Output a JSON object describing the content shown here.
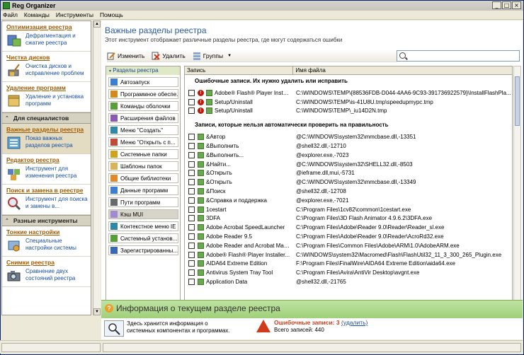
{
  "window": {
    "title": "Reg Organizer",
    "min": "_",
    "max": "□",
    "close": "×"
  },
  "menu": [
    "Файл",
    "Команды",
    "Инструменты",
    "Помощь"
  ],
  "sidebar": {
    "top_tools": [
      {
        "title": "Оптимизация реестра",
        "desc": "Дефрагментация и сжатие реестра"
      },
      {
        "title": "Чистка дисков",
        "desc": "Очистка дисков и исправление проблем"
      },
      {
        "title": "Удаление программ",
        "desc": "Удаление и установка программ"
      }
    ],
    "group1": "Для специалистов",
    "spec_tools": [
      {
        "title": "Важные разделы реестра",
        "desc": "Показ важных разделов реестра",
        "selected": true
      },
      {
        "title": "Редактор реестра",
        "desc": "Инструмент для изменения реестра"
      },
      {
        "title": "Поиск и замена в реестре",
        "desc": "Инструмент для поиска и замены в..."
      }
    ],
    "group2": "Разные инструменты",
    "misc_tools": [
      {
        "title": "Тонкие настройки",
        "desc": "Специальные настройки системы"
      },
      {
        "title": "Снимки реестра",
        "desc": "Сравнение двух состояний реестра"
      }
    ]
  },
  "page": {
    "title": "Важные разделы реестра",
    "subtitle": "Этот инструмент отображает различные разделы реестра, где могут содержаться ошибки"
  },
  "toolbar": {
    "edit": "Изменить",
    "delete": "Удалить",
    "groups": "Группы",
    "groups_arrow": "▼"
  },
  "search": {
    "placeholder": ""
  },
  "categories": {
    "header": "Разделы реестра",
    "items": [
      "Автозапуск",
      "Программное обеспе...",
      "Команды оболочки",
      "Расширения файлов",
      "Меню \"Создать\"",
      "Меню \"Открыть с п...",
      "Системные папки",
      "Шаблоны папок",
      "Общие библиотеки",
      "Данные программ",
      "Пути программ",
      "Кэш MUI",
      "Контекстное меню IE",
      "Системный установ...",
      "Зарегистрированны..."
    ],
    "selected_index": 11
  },
  "list": {
    "col_entry": "Запись",
    "col_file": "Имя файла",
    "section1": "Ошибочные записи. Их нужно удалить или исправить",
    "errors": [
      {
        "name": "Adobe® Flash® Player Installer...",
        "path": "C:\\WINDOWS\\TEMP\\{88536FDB-D044-4AA6-9C93-391736922579}\\InstallFlashPla..."
      },
      {
        "name": "Setup/Uninstall",
        "path": "C:\\WINDOWS\\TEMP\\is-41U8U.tmp\\speedupmypc.tmp"
      },
      {
        "name": "Setup/Uninstall",
        "path": "C:\\WINDOWS\\TEMP\\_iu14D2N.tmp"
      }
    ],
    "section2": "Записи, которые нельзя автоматически проверить на правильность",
    "entries": [
      {
        "name": "&Автор",
        "path": "@C:\\WINDOWS\\system32\\mmcbase.dll,-13351"
      },
      {
        "name": "&Выполнить",
        "path": "@shell32.dll,-12710"
      },
      {
        "name": "&Выполнить...",
        "path": "@explorer.exe,-7023"
      },
      {
        "name": "&Найти...",
        "path": "@C:\\WINDOWS\\system32\\SHELL32.dll,-8503"
      },
      {
        "name": "&Открыть",
        "path": "@ieframe.dll,mui,-5731"
      },
      {
        "name": "&Открыть",
        "path": "@C:\\WINDOWS\\system32\\mmcbase.dll,-13349"
      },
      {
        "name": "&Поиск",
        "path": "@shell32.dll,-12708"
      },
      {
        "name": "&Справка и поддержка",
        "path": "@explorer.exe,-7021"
      },
      {
        "name": "1cestart",
        "path": "C:\\Program Files\\1cv82\\common\\1cestart.exe"
      },
      {
        "name": "3DFA",
        "path": "C:\\Program Files\\3D Flash Animator 4.9.6.2\\3DFA.exe"
      },
      {
        "name": "Adobe Acrobat SpeedLauncher",
        "path": "C:\\Program Files\\Adobe\\Reader 9.0\\Reader\\Reader_sl.exe"
      },
      {
        "name": "Adobe Reader 9.5",
        "path": "C:\\Program Files\\Adobe\\Reader 9.0\\Reader\\AcroRd32.exe"
      },
      {
        "name": "Adobe Reader and Acrobat Man...",
        "path": "C:\\Program Files\\Common Files\\Adobe\\ARM\\1.0\\AdobeARM.exe"
      },
      {
        "name": "Adobe® Flash® Player Installer...",
        "path": "C:\\WINDOWS\\system32\\Macromed\\Flash\\FlashUtil32_11_3_300_265_Plugin.exe"
      },
      {
        "name": "AIDA64 Extreme Edition",
        "path": "F:\\Program Files\\FinalWire\\AIDA64 Extreme Edition\\aida64.exe"
      },
      {
        "name": "Antivirus System Tray Tool",
        "path": "C:\\Program Files\\Avira\\AntiVir Desktop\\avgnt.exe"
      },
      {
        "name": "Application Data",
        "path": "@shell32.dll,-21765"
      }
    ]
  },
  "info": {
    "title": "Информация о текущем разделе реестра",
    "desc": "Здесь хранится информация о системных компонентах и программах.",
    "errors_label": "Ошибочные записи: 3",
    "delete_link": "(удалить)",
    "total": "Всего записей: 440"
  },
  "colors": {
    "accent": "#2a5aa8",
    "link": "#1a4fa0",
    "error": "#d13b1b",
    "info_bg": "#a9d685"
  }
}
